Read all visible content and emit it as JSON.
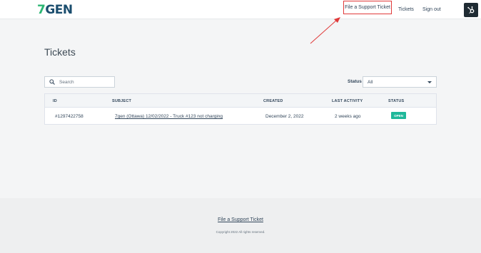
{
  "header": {
    "logo_text": "7GEN",
    "logo_seven": "7",
    "logo_rest": "GEN",
    "nav": {
      "file_ticket": "File a Support Ticket",
      "tickets": "Tickets",
      "sign_out": "Sign out"
    },
    "hub_icon": "hubspot-sprocket-icon"
  },
  "page": {
    "title": "Tickets"
  },
  "search": {
    "placeholder": "Search",
    "value": ""
  },
  "filter": {
    "status_label": "Status",
    "status_value": "All"
  },
  "table": {
    "columns": [
      "ID",
      "SUBJECT",
      "CREATED",
      "LAST ACTIVITY",
      "STATUS"
    ],
    "rows": [
      {
        "id": "#1297422758",
        "subject": "7gen (Ottawa) 12/02/2022 - Truck #123 not charging",
        "created": "December 2, 2022",
        "last_activity": "2 weeks ago",
        "status": "OPEN"
      }
    ]
  },
  "footer": {
    "link": "File a Support Ticket",
    "copyright": "Copyright 2022 All rights reserved."
  },
  "colors": {
    "annotation_red": "#e03a3a",
    "status_open": "#1fb89a",
    "brand_green": "#2bb673",
    "brand_blue": "#1a4d6e"
  }
}
